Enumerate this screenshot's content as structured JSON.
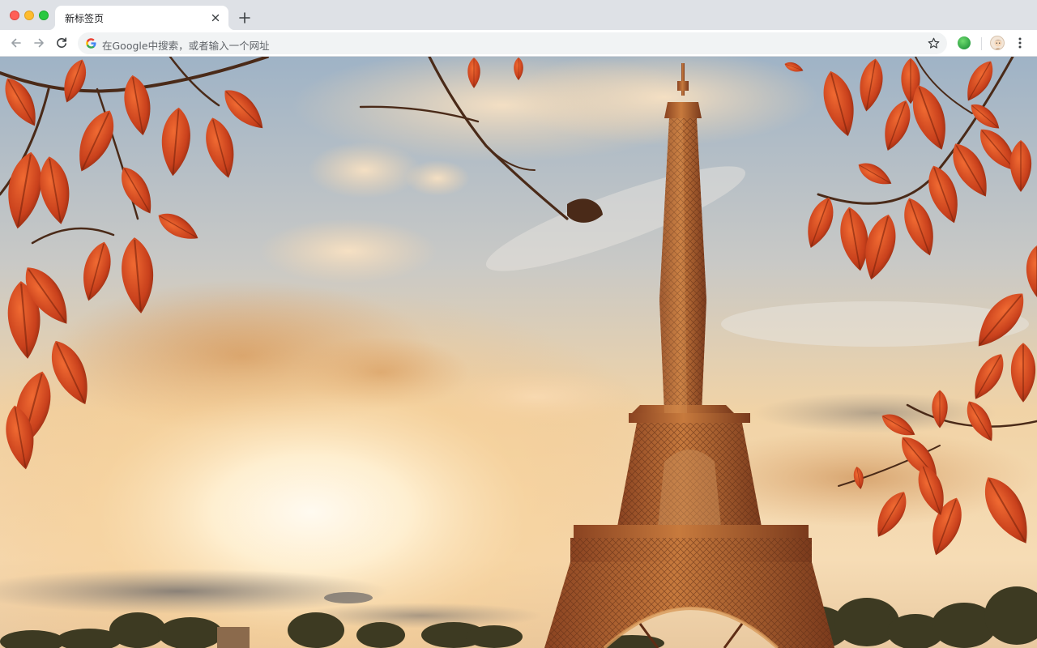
{
  "window": {
    "controls": [
      "close",
      "minimize",
      "maximize"
    ]
  },
  "tab": {
    "title": "新标签页",
    "close_icon": "close-icon"
  },
  "new_tab": {
    "icon": "plus-icon"
  },
  "toolbar": {
    "back_icon": "arrow-left-icon",
    "forward_icon": "arrow-right-icon",
    "reload_icon": "reload-icon",
    "omnibox": {
      "icon": "google-g-icon",
      "placeholder": "在Google中搜索，或者输入一个网址"
    },
    "bookmark_icon": "star-icon",
    "extension_icon": "green-extension-icon",
    "profile_icon": "avatar",
    "menu_icon": "kebab-menu-icon"
  },
  "wallpaper": {
    "subject": "eiffel-tower-autumn",
    "colors": {
      "sky_top": "#9eb4c9",
      "sun": "#fff3d6",
      "leaf": "#c8401c",
      "tower": "#a85a2a"
    }
  }
}
